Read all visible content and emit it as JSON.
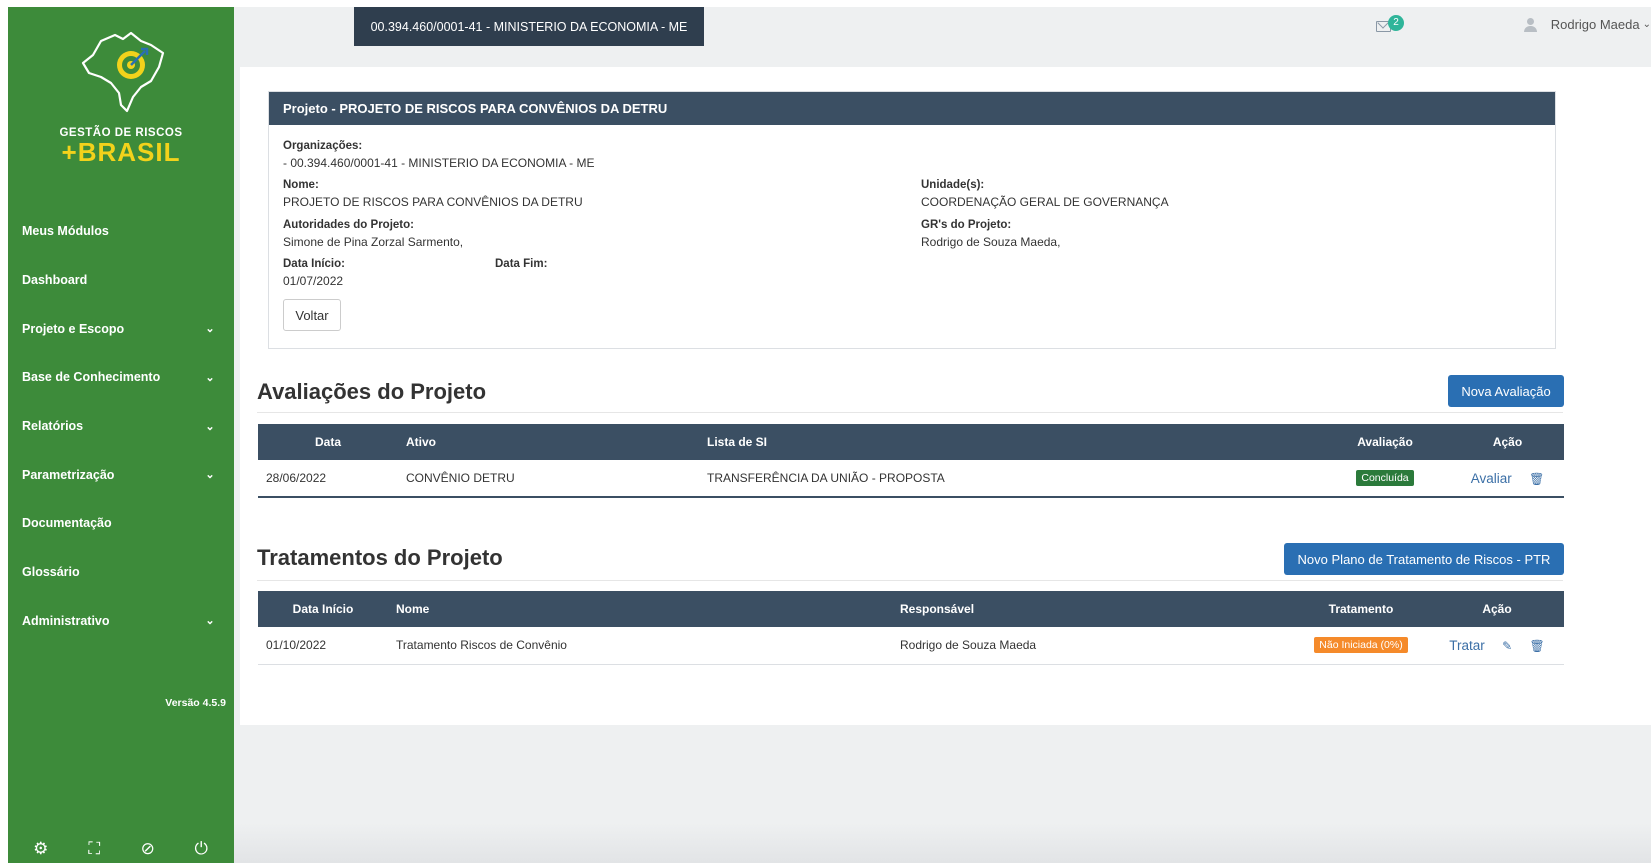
{
  "sidebar": {
    "logo_top": "GESTÃO DE RISCOS",
    "logo_bottom": "+BRASIL",
    "items": [
      {
        "label": "Meus Módulos",
        "chevron": false
      },
      {
        "label": "Dashboard",
        "chevron": false
      },
      {
        "label": "Projeto e Escopo",
        "chevron": true
      },
      {
        "label": "Base de Conhecimento",
        "chevron": true
      },
      {
        "label": "Relatórios",
        "chevron": true
      },
      {
        "label": "Parametrização",
        "chevron": true
      },
      {
        "label": "Documentação",
        "chevron": false
      },
      {
        "label": "Glossário",
        "chevron": false
      },
      {
        "label": "Administrativo",
        "chevron": true
      }
    ],
    "version": "Versão 4.5.9",
    "footer_icons": [
      "gear-icon",
      "fullscreen-icon",
      "eye-slash-icon",
      "power-icon"
    ]
  },
  "topbar": {
    "organization": "00.394.460/0001-41 - MINISTERIO DA ECONOMIA - ME",
    "mail_count": "2",
    "user_name": "Rodrigo Maeda"
  },
  "project": {
    "header": "Projeto - PROJETO DE RISCOS PARA CONVÊNIOS DA DETRU",
    "org_label": "Organizações:",
    "org_value": "- 00.394.460/0001-41 - MINISTERIO DA ECONOMIA - ME",
    "name_label": "Nome:",
    "name_value": "PROJETO DE RISCOS PARA CONVÊNIOS DA DETRU",
    "unit_label": "Unidade(s):",
    "unit_value": "COORDENAÇÃO GERAL DE GOVERNANÇA",
    "authorities_label": "Autoridades do Projeto:",
    "authorities_value": "Simone de Pina Zorzal Sarmento,",
    "grs_label": "GR's do Projeto:",
    "grs_value": "Rodrigo de Souza Maeda,",
    "start_label": "Data Início:",
    "start_value": "01/07/2022",
    "end_label": "Data Fim:",
    "back_button": "Voltar"
  },
  "evaluations": {
    "title": "Avaliações do Projeto",
    "new_button": "Nova Avaliação",
    "columns": [
      "Data",
      "Ativo",
      "Lista de SI",
      "Avaliação",
      "Ação"
    ],
    "rows": [
      {
        "date": "28/06/2022",
        "asset": "CONVÊNIO DETRU",
        "list": "TRANSFERÊNCIA DA UNIÃO - PROPOSTA",
        "status": "Concluída",
        "status_color": "#2b7a3b",
        "action": "Avaliar"
      }
    ]
  },
  "treatments": {
    "title": "Tratamentos do Projeto",
    "new_button": "Novo Plano de Tratamento de Riscos - PTR",
    "columns": [
      "Data Início",
      "Nome",
      "Responsável",
      "Tratamento",
      "Ação"
    ],
    "rows": [
      {
        "date": "01/10/2022",
        "name": "Tratamento Riscos de Convênio",
        "responsible": "Rodrigo de Souza Maeda",
        "status": "Não Iniciada (0%)",
        "status_color": "#f58a2a",
        "action": "Tratar"
      }
    ]
  },
  "colors": {
    "sidebar": "#3d8b3a",
    "header_dark": "#3b4f63",
    "primary": "#2a6fb3",
    "logo_yellow": "#f2d21b"
  }
}
